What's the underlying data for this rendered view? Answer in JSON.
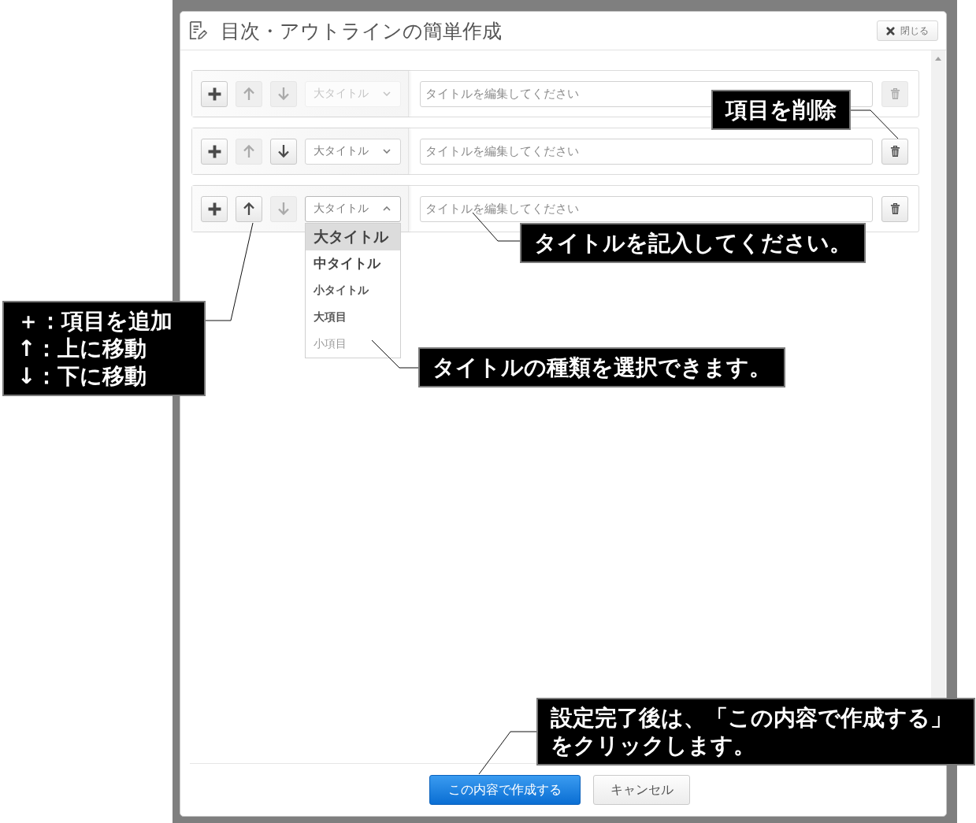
{
  "dialog": {
    "title": "目次・アウトラインの簡単作成",
    "close_label": "閉じる"
  },
  "rows": [
    {
      "up_disabled": true,
      "down_disabled": true,
      "level_value": "大タイトル",
      "level_disabled": true,
      "expanded": false,
      "placeholder": "タイトルを編集してください",
      "delete_disabled": true
    },
    {
      "up_disabled": true,
      "down_disabled": false,
      "level_value": "大タイトル",
      "level_disabled": false,
      "expanded": false,
      "placeholder": "タイトルを編集してください",
      "delete_disabled": false
    },
    {
      "up_disabled": false,
      "down_disabled": true,
      "level_value": "大タイトル",
      "level_disabled": false,
      "expanded": true,
      "placeholder": "タイトルを編集してください",
      "delete_disabled": false
    }
  ],
  "level_menu": [
    {
      "label": "大タイトル",
      "kind": "title1",
      "selected": true
    },
    {
      "label": "中タイトル",
      "kind": "title2",
      "selected": false
    },
    {
      "label": "小タイトル",
      "kind": "title3",
      "selected": false
    },
    {
      "label": "大項目",
      "kind": "item1",
      "selected": false
    },
    {
      "label": "小項目",
      "kind": "item2",
      "selected": false
    }
  ],
  "footer": {
    "create_label": "この内容で作成する",
    "cancel_label": "キャンセル"
  },
  "callouts": [
    {
      "kind": "delete",
      "lines": [
        "項目を削除"
      ]
    },
    {
      "kind": "input",
      "lines": [
        "タイトルを記入してください。"
      ]
    },
    {
      "kind": "buttons",
      "lines": [
        "＋：項目を追加",
        "↑：上に移動",
        "↓：下に移動"
      ]
    },
    {
      "kind": "levels",
      "lines": [
        "タイトルの種類を選択できます。"
      ]
    },
    {
      "kind": "create",
      "lines": [
        "設定完了後は、「この内容で作成する」をクリックします。"
      ]
    }
  ]
}
